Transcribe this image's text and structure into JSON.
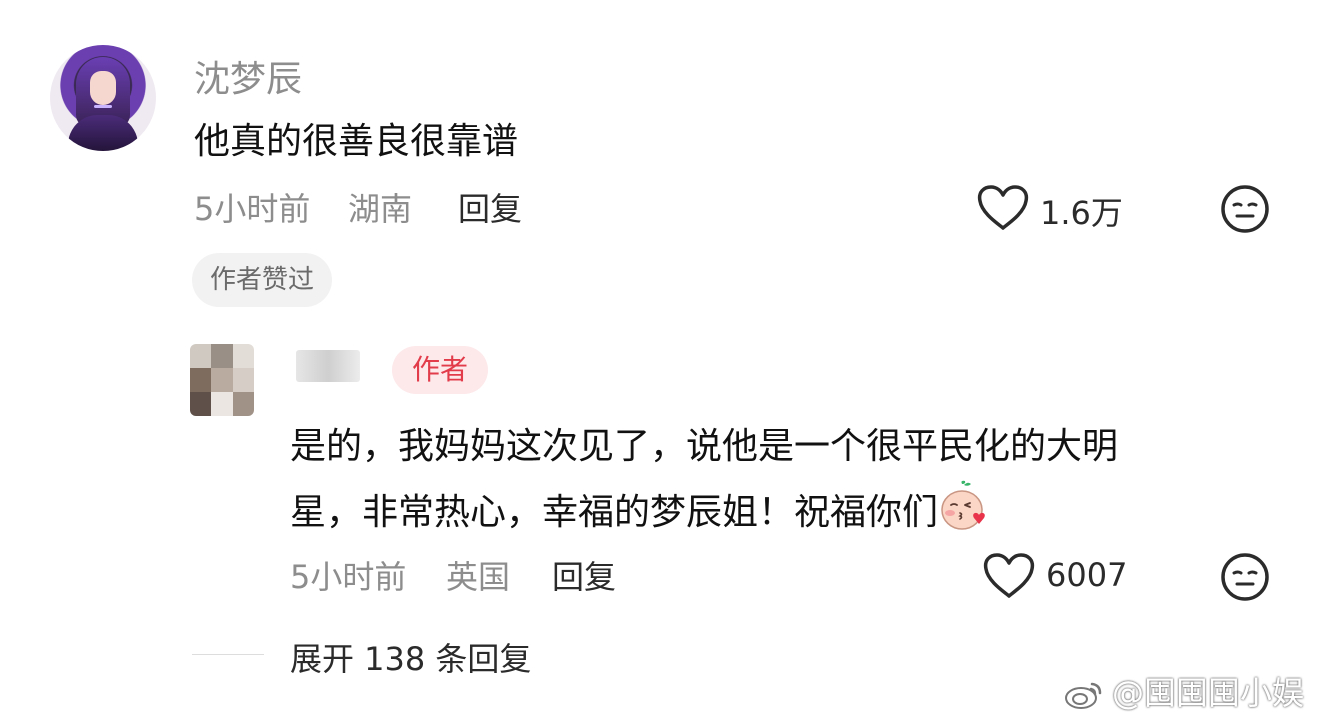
{
  "comment": {
    "username": "沈梦辰",
    "text": "他真的很善良很靠谱",
    "time": "5小时前",
    "location": "湖南",
    "reply_label": "回复",
    "likes": "1.6万",
    "author_liked_badge": "作者赞过"
  },
  "reply": {
    "author_badge": "作者",
    "text_line1": "是的，我妈妈这次见了，说他是一个很平民化的大明",
    "text_line2": "星，非常热心，幸福的梦辰姐！祝福你们",
    "time": "5小时前",
    "location": "英国",
    "reply_label": "回复",
    "likes": "6007"
  },
  "expand": {
    "label": "展开 138 条回复"
  },
  "watermark": {
    "text": "@囤囤囤小娱"
  },
  "icons": {
    "like": "heart-outline-icon",
    "dislike": "neutral-face-icon",
    "emoji": "kiss-face-emoji"
  }
}
